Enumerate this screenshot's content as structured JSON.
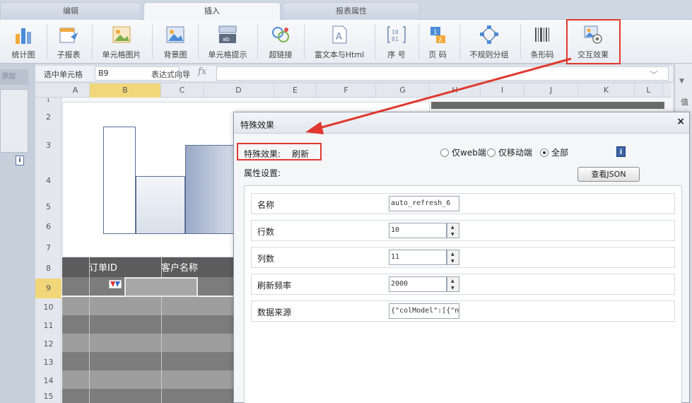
{
  "tabs": [
    {
      "label": "编辑",
      "active": false
    },
    {
      "label": "插入",
      "active": true
    },
    {
      "label": "报表属性",
      "active": false
    }
  ],
  "toolbar": {
    "items": [
      {
        "label": "统计图",
        "icon": "bar-chart-icon"
      },
      {
        "label": "子报表",
        "icon": "subreport-icon"
      },
      {
        "label": "单元格图片",
        "icon": "cell-image-icon"
      },
      {
        "label": "背景图",
        "icon": "background-image-icon"
      },
      {
        "label": "单元格提示",
        "icon": "cell-tooltip-icon"
      },
      {
        "label": "超链接",
        "icon": "hyperlink-icon"
      },
      {
        "label": "富文本与Html",
        "icon": "rich-text-icon"
      },
      {
        "label": "序 号",
        "icon": "sequence-icon"
      },
      {
        "label": "页 码",
        "icon": "page-number-icon"
      },
      {
        "label": "不规则分组",
        "icon": "irregular-group-icon"
      },
      {
        "label": "条形码",
        "icon": "barcode-icon"
      },
      {
        "label": "交互效果",
        "icon": "interaction-effect-icon"
      }
    ]
  },
  "formula_bar": {
    "selected_cell_label": "选中单元格",
    "selected_cell_value": "B9",
    "expression_label": "表达式向导",
    "fx": "fx"
  },
  "left_pane": {
    "add_label": "添加",
    "info": "i"
  },
  "right_strip": {
    "label": "值"
  },
  "sheet": {
    "columns": [
      "A",
      "B",
      "C",
      "D",
      "E",
      "F",
      "G",
      "H",
      "I",
      "J",
      "K",
      "L"
    ],
    "selected_column": "B",
    "rows": [
      "1",
      "2",
      "3",
      "4",
      "5",
      "6",
      "7",
      "8",
      "9",
      "10",
      "11",
      "12",
      "13",
      "14",
      "15"
    ],
    "selected_row": "9",
    "table_headers": [
      "订单ID",
      "客户名称"
    ]
  },
  "dialog": {
    "title": "特殊效果",
    "close": "×",
    "effect_label": "特殊效果:",
    "effect_value": "刷新",
    "radios": [
      {
        "label": "仅web端",
        "checked": false
      },
      {
        "label": "仅移动端",
        "checked": false
      },
      {
        "label": "全部",
        "checked": true
      }
    ],
    "info": "i",
    "properties_label": "属性设置:",
    "json_button": "查看JSON",
    "properties": [
      {
        "name": "名称",
        "value": "auto_refresh_6",
        "spinner": false
      },
      {
        "name": "行数",
        "value": "10",
        "spinner": true
      },
      {
        "name": "列数",
        "value": "11",
        "spinner": true
      },
      {
        "name": "刷新频率",
        "value": "2000",
        "spinner": true
      },
      {
        "name": "数据来源",
        "value": "{\"colModel\":[{\"na",
        "spinner": false
      }
    ]
  },
  "colors": {
    "highlight_red": "#e0392f",
    "ribbon_bg": "#e9edf2",
    "selection_yellow": "#f1d77a"
  }
}
